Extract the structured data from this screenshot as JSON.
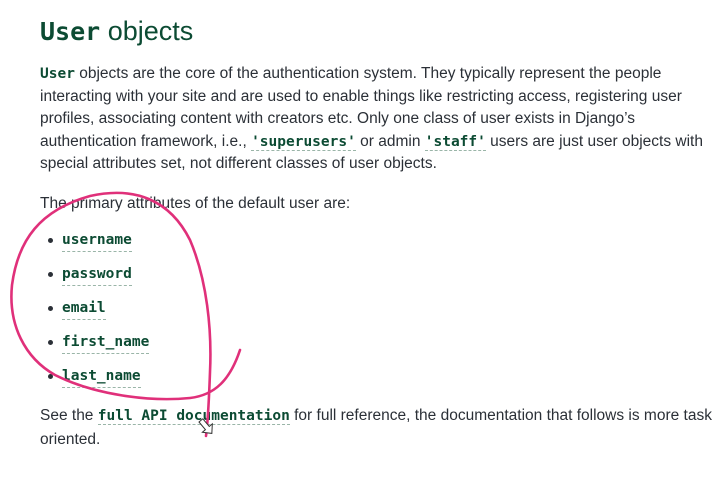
{
  "heading": {
    "code": "User",
    "text": " objects"
  },
  "intro": {
    "code_user": "User",
    "t1": " objects are the core of the authentication system. They typically represent the people interacting with your site and are used to enable things like restricting access, registering user profiles, associating content with creators etc. Only one class of user exists in Django’s authentication framework, i.e., ",
    "code_superusers": "'superusers'",
    "t2": " or admin ",
    "code_staff": "'staff'",
    "t3": " users are just user objects with special attributes set, not different classes of user objects."
  },
  "primary": "The primary attributes of the default user are:",
  "attributes": [
    "username",
    "password",
    "email",
    "first_name",
    "last_name"
  ],
  "see_also": {
    "t1": "See the ",
    "link": "full API documentation",
    "t2": " for full reference, the documentation that follows is more task oriented."
  },
  "annotation": {
    "color": "#e0307a"
  }
}
